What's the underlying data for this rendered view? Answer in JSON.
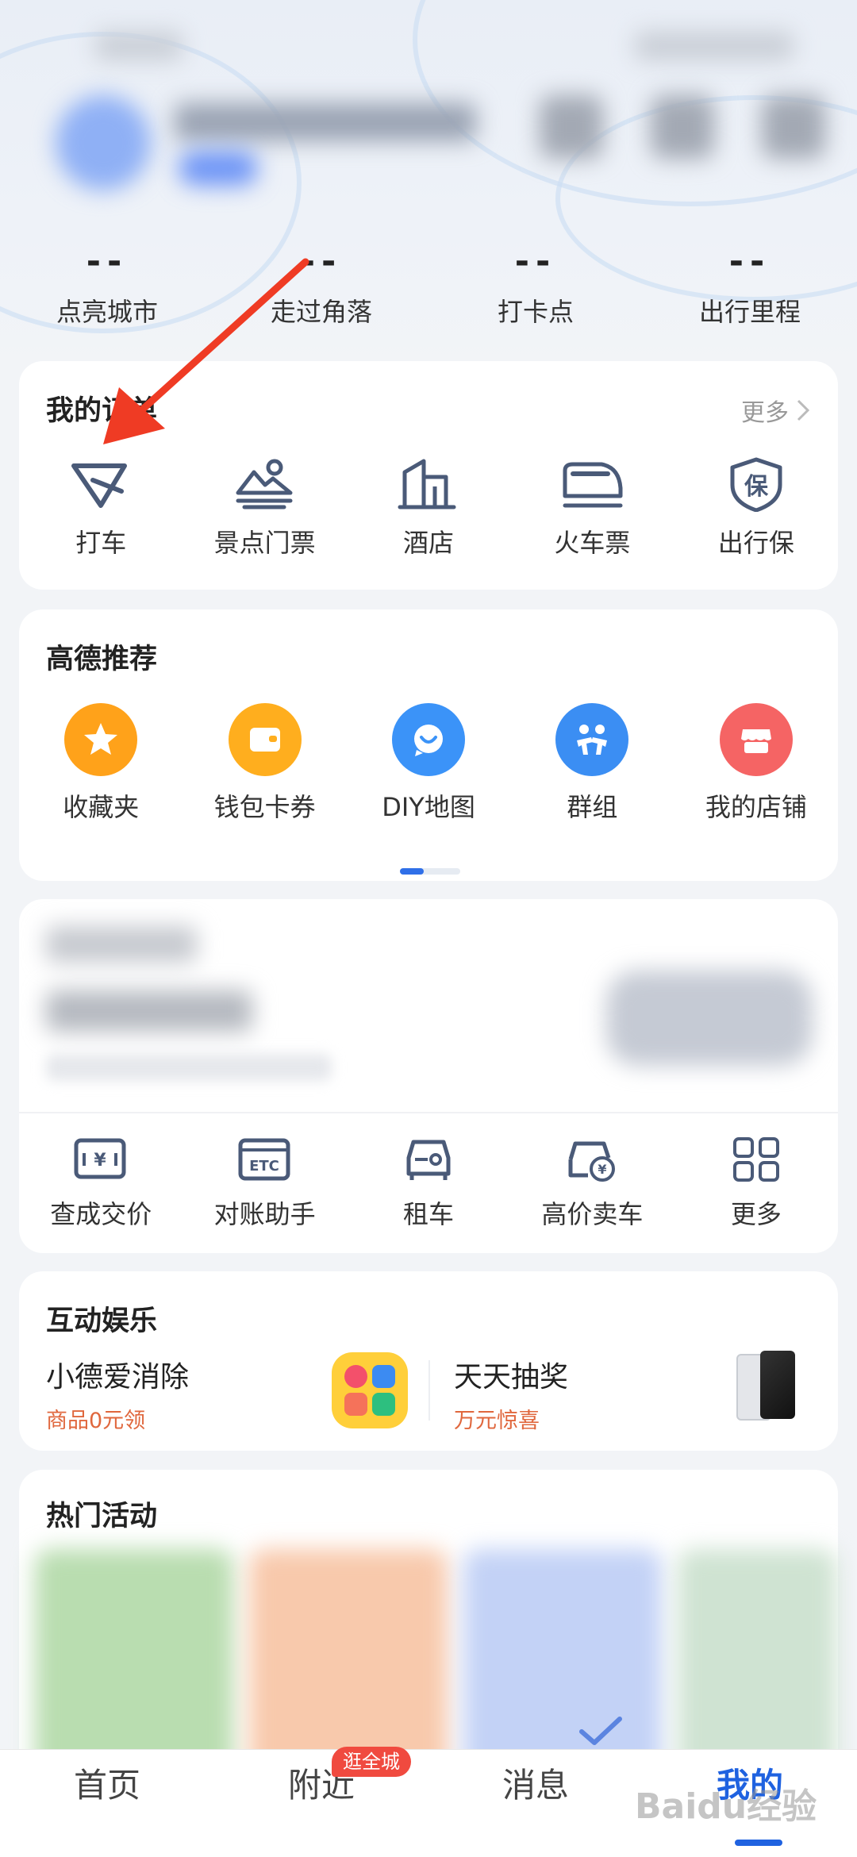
{
  "stats": [
    {
      "value": "--",
      "label": "点亮城市"
    },
    {
      "value": "--",
      "label": "走过角落"
    },
    {
      "value": "--",
      "label": "打卡点"
    },
    {
      "value": "--",
      "label": "出行里程"
    }
  ],
  "orders": {
    "title": "我的订单",
    "more": "更多",
    "items": [
      {
        "label": "打车",
        "icon": "taxi-icon"
      },
      {
        "label": "景点门票",
        "icon": "scenic-ticket-icon"
      },
      {
        "label": "酒店",
        "icon": "hotel-icon"
      },
      {
        "label": "火车票",
        "icon": "train-icon"
      },
      {
        "label": "出行保",
        "icon": "insurance-shield-icon"
      }
    ]
  },
  "recommend": {
    "title": "高德推荐",
    "items": [
      {
        "label": "收藏夹",
        "icon": "star-icon",
        "color": "#ffa21a"
      },
      {
        "label": "钱包卡券",
        "icon": "wallet-icon",
        "color": "#ffae1e"
      },
      {
        "label": "DIY地图",
        "icon": "diy-map-icon",
        "color": "#3b93f8"
      },
      {
        "label": "群组",
        "icon": "group-icon",
        "color": "#3b8ef3"
      },
      {
        "label": "我的店铺",
        "icon": "shop-icon",
        "color": "#f56464"
      }
    ]
  },
  "car": {
    "items": [
      {
        "label": "查成交价",
        "icon": "price-check-icon"
      },
      {
        "label": "对账助手",
        "icon": "etc-icon"
      },
      {
        "label": "租车",
        "icon": "rent-car-icon"
      },
      {
        "label": "高价卖车",
        "icon": "sell-car-icon"
      },
      {
        "label": "更多",
        "icon": "grid-more-icon"
      }
    ]
  },
  "entertainment": {
    "title": "互动娱乐",
    "game": {
      "title": "小德爱消除",
      "subtitle": "商品0元领"
    },
    "lottery": {
      "title": "天天抽奖",
      "subtitle": "万元惊喜"
    }
  },
  "hot": {
    "title": "热门活动"
  },
  "nav": {
    "items": [
      {
        "label": "首页"
      },
      {
        "label": "附近",
        "badge": "逛全城"
      },
      {
        "label": "消息"
      },
      {
        "label": "我的"
      }
    ]
  },
  "colors": {
    "accent": "#1f62e0",
    "orderIcon": "#4a5a78",
    "badge": "#f04a3f",
    "subtitle": "#e0673d"
  },
  "watermark": "Baidu经验"
}
